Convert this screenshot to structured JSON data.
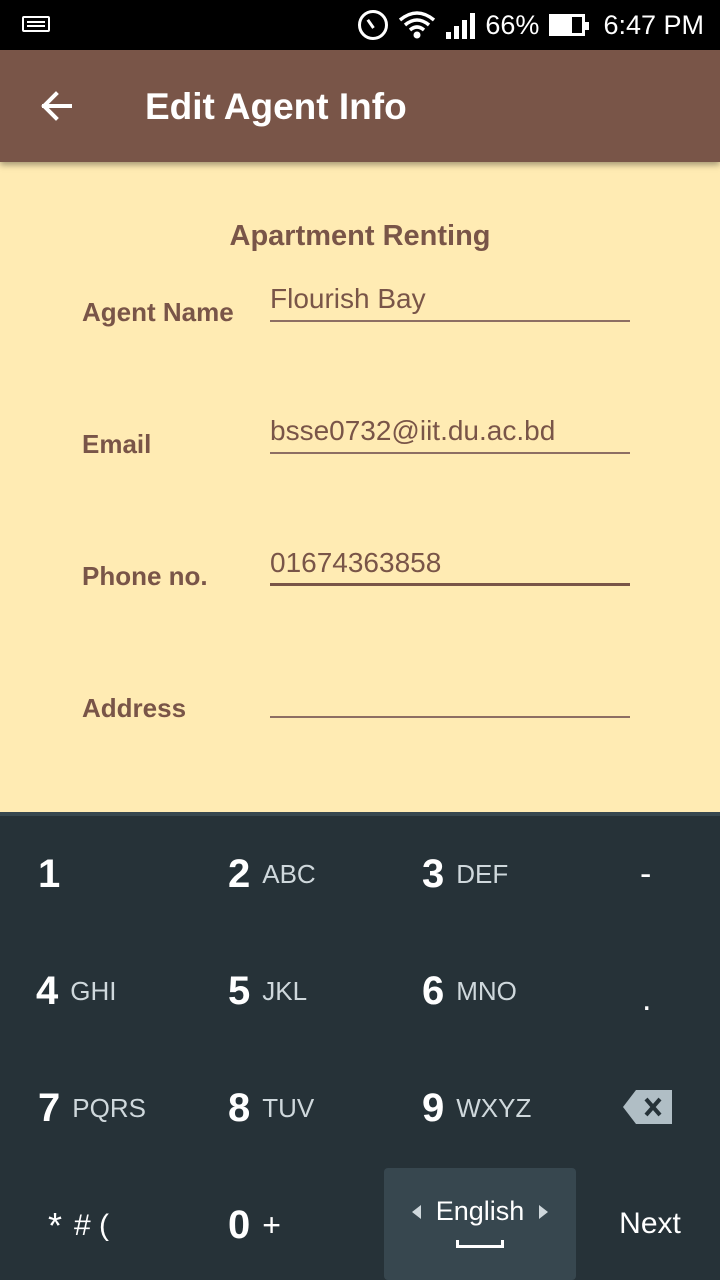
{
  "status_bar": {
    "battery": "66%",
    "time": "6:47 PM",
    "icons": [
      "keyboard-icon",
      "alarm-icon",
      "wifi-icon",
      "signal-icon",
      "battery-icon"
    ]
  },
  "app_bar": {
    "title": "Edit Agent Info",
    "back_icon": "arrow-left-icon",
    "color": "#795548"
  },
  "form": {
    "title": "Apartment Renting",
    "background": "#FFEBB3",
    "fields": [
      {
        "label": "Agent Name",
        "value": "Flourish Bay"
      },
      {
        "label": "Email",
        "value": "bsse0732@iit.du.ac.bd"
      },
      {
        "label": "Phone no.",
        "value": "01674363858",
        "focused": true
      },
      {
        "label": "Address",
        "value": ""
      }
    ]
  },
  "keyboard": {
    "keys": [
      {
        "digit": "1",
        "letters": ""
      },
      {
        "digit": "2",
        "letters": "ABC"
      },
      {
        "digit": "3",
        "letters": "DEF"
      },
      {
        "digit": "-",
        "letters": ""
      },
      {
        "digit": "4",
        "letters": "GHI"
      },
      {
        "digit": "5",
        "letters": "JKL"
      },
      {
        "digit": "6",
        "letters": "MNO"
      },
      {
        "digit": ".",
        "letters": ""
      },
      {
        "digit": "7",
        "letters": "PQRS"
      },
      {
        "digit": "8",
        "letters": "TUV"
      },
      {
        "digit": "9",
        "letters": "WXYZ"
      },
      {
        "digit": "*",
        "letters": "# ("
      },
      {
        "digit": "0",
        "letters": "+"
      }
    ],
    "language": "English",
    "action": "Next",
    "backspace_icon": "backspace-icon"
  }
}
